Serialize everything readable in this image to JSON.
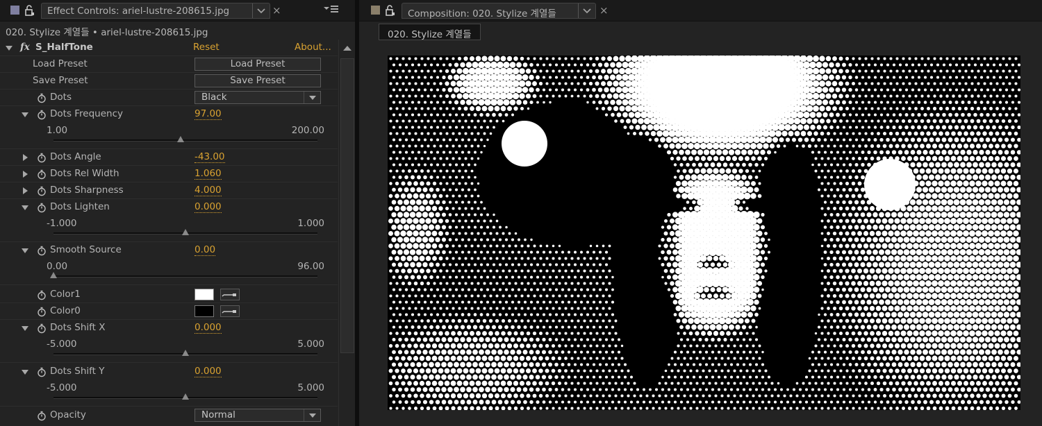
{
  "effect_controls": {
    "tab_title": "Effect Controls: ariel-lustre-208615.jpg",
    "close_glyph": "×",
    "subtitle": "020. Stylize 계열들 • ariel-lustre-208615.jpg",
    "effect": {
      "fx_glyph": "fx",
      "name": "S_HalfTone",
      "reset_label": "Reset",
      "about_label": "About..."
    },
    "rows": {
      "load_preset": {
        "label": "Load Preset",
        "button": "Load Preset"
      },
      "save_preset": {
        "label": "Save Preset",
        "button": "Save Preset"
      },
      "dots": {
        "label": "Dots",
        "value": "Black"
      },
      "dots_frequency": {
        "label": "Dots Frequency",
        "value": "97.00",
        "min": "1.00",
        "max": "200.00",
        "slider_fraction": 0.482
      },
      "dots_angle": {
        "label": "Dots Angle",
        "value": "-43.00"
      },
      "dots_rel_width": {
        "label": "Dots Rel Width",
        "value": "1.060"
      },
      "dots_sharpness": {
        "label": "Dots Sharpness",
        "value": "4.000"
      },
      "dots_lighten": {
        "label": "Dots Lighten",
        "value": "0.000",
        "min": "-1.000",
        "max": "1.000",
        "slider_fraction": 0.5
      },
      "smooth_source": {
        "label": "Smooth Source",
        "value": "0.00",
        "min": "0.00",
        "max": "96.00",
        "slider_fraction": 0.0
      },
      "color1": {
        "label": "Color1",
        "color": "#ffffff"
      },
      "color0": {
        "label": "Color0",
        "color": "#000000"
      },
      "dots_shift_x": {
        "label": "Dots Shift X",
        "value": "0.000",
        "min": "-5.000",
        "max": "5.000",
        "slider_fraction": 0.5
      },
      "dots_shift_y": {
        "label": "Dots Shift Y",
        "value": "0.000",
        "min": "-5.000",
        "max": "5.000",
        "slider_fraction": 0.5
      },
      "opacity": {
        "label": "Opacity",
        "value": "Normal"
      }
    }
  },
  "composition": {
    "tab_title": "Composition: 020. Stylize 계열들",
    "close_glyph": "×",
    "comp_tab": "020. Stylize 계열들"
  },
  "colors": {
    "accent": "#d9a231",
    "panel_bg": "#232323",
    "label_swatch_left": "#7f7fa0",
    "label_swatch_right": "#8a7f6a"
  },
  "icons": [
    "comp-color-swatch-icon",
    "lock-icon",
    "chevron-down-icon",
    "close-icon",
    "panel-menu-icon",
    "stopwatch-icon",
    "twirl-triangle-icon",
    "eyedropper-icon",
    "scroll-up-arrow-icon"
  ]
}
